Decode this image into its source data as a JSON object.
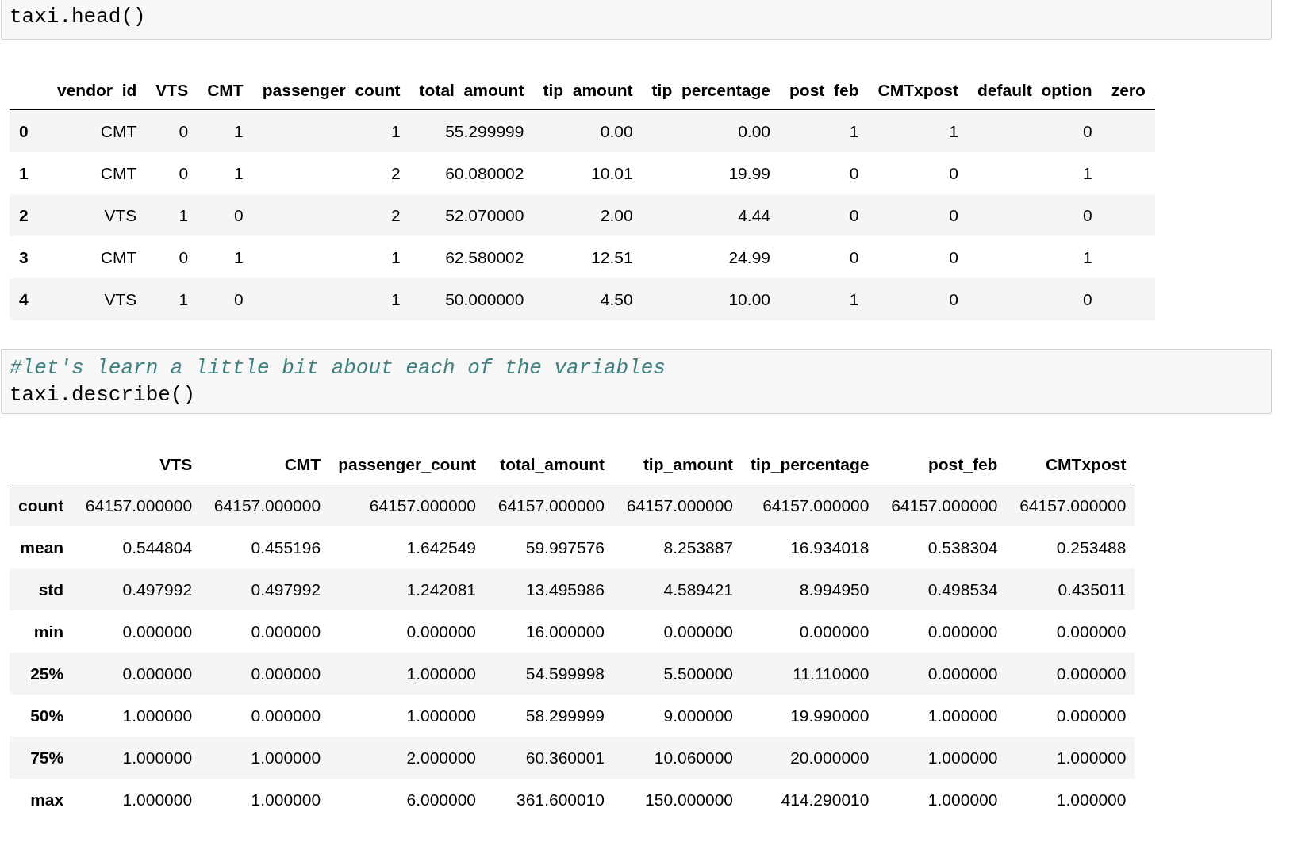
{
  "cells": [
    {
      "kind": "code",
      "lines": [
        {
          "kind": "code",
          "text": "taxi.head()"
        }
      ]
    },
    {
      "kind": "dataframe",
      "columns": [
        "",
        "vendor_id",
        "VTS",
        "CMT",
        "passenger_count",
        "total_amount",
        "tip_amount",
        "tip_percentage",
        "post_feb",
        "CMTxpost",
        "default_option",
        "zero_"
      ],
      "rows": [
        [
          "0",
          "CMT",
          "0",
          "1",
          "1",
          "55.299999",
          "0.00",
          "0.00",
          "1",
          "1",
          "0",
          ""
        ],
        [
          "1",
          "CMT",
          "0",
          "1",
          "2",
          "60.080002",
          "10.01",
          "19.99",
          "0",
          "0",
          "1",
          ""
        ],
        [
          "2",
          "VTS",
          "1",
          "0",
          "2",
          "52.070000",
          "2.00",
          "4.44",
          "0",
          "0",
          "0",
          ""
        ],
        [
          "3",
          "CMT",
          "0",
          "1",
          "1",
          "62.580002",
          "12.51",
          "24.99",
          "0",
          "0",
          "1",
          ""
        ],
        [
          "4",
          "VTS",
          "1",
          "0",
          "1",
          "50.000000",
          "4.50",
          "10.00",
          "1",
          "0",
          "0",
          ""
        ]
      ]
    },
    {
      "kind": "code",
      "lines": [
        {
          "kind": "comment",
          "text": "#let's learn a little bit about each of the variables"
        },
        {
          "kind": "code",
          "text": "taxi.describe()"
        }
      ]
    },
    {
      "kind": "summary",
      "columns": [
        "",
        "VTS",
        "CMT",
        "passenger_count",
        "total_amount",
        "tip_amount",
        "tip_percentage",
        "post_feb",
        "CMTxpost"
      ],
      "rows": [
        [
          "count",
          "64157.000000",
          "64157.000000",
          "64157.000000",
          "64157.000000",
          "64157.000000",
          "64157.000000",
          "64157.000000",
          "64157.000000"
        ],
        [
          "mean",
          "0.544804",
          "0.455196",
          "1.642549",
          "59.997576",
          "8.253887",
          "16.934018",
          "0.538304",
          "0.253488"
        ],
        [
          "std",
          "0.497992",
          "0.497992",
          "1.242081",
          "13.495986",
          "4.589421",
          "8.994950",
          "0.498534",
          "0.435011"
        ],
        [
          "min",
          "0.000000",
          "0.000000",
          "0.000000",
          "16.000000",
          "0.000000",
          "0.000000",
          "0.000000",
          "0.000000"
        ],
        [
          "25%",
          "0.000000",
          "0.000000",
          "1.000000",
          "54.599998",
          "5.500000",
          "11.110000",
          "0.000000",
          "0.000000"
        ],
        [
          "50%",
          "1.000000",
          "0.000000",
          "1.000000",
          "58.299999",
          "9.000000",
          "19.990000",
          "1.000000",
          "0.000000"
        ],
        [
          "75%",
          "1.000000",
          "1.000000",
          "2.000000",
          "60.360001",
          "10.060000",
          "20.000000",
          "1.000000",
          "1.000000"
        ],
        [
          "max",
          "1.000000",
          "1.000000",
          "6.000000",
          "361.600010",
          "150.000000",
          "414.290010",
          "1.000000",
          "1.000000"
        ]
      ]
    }
  ]
}
